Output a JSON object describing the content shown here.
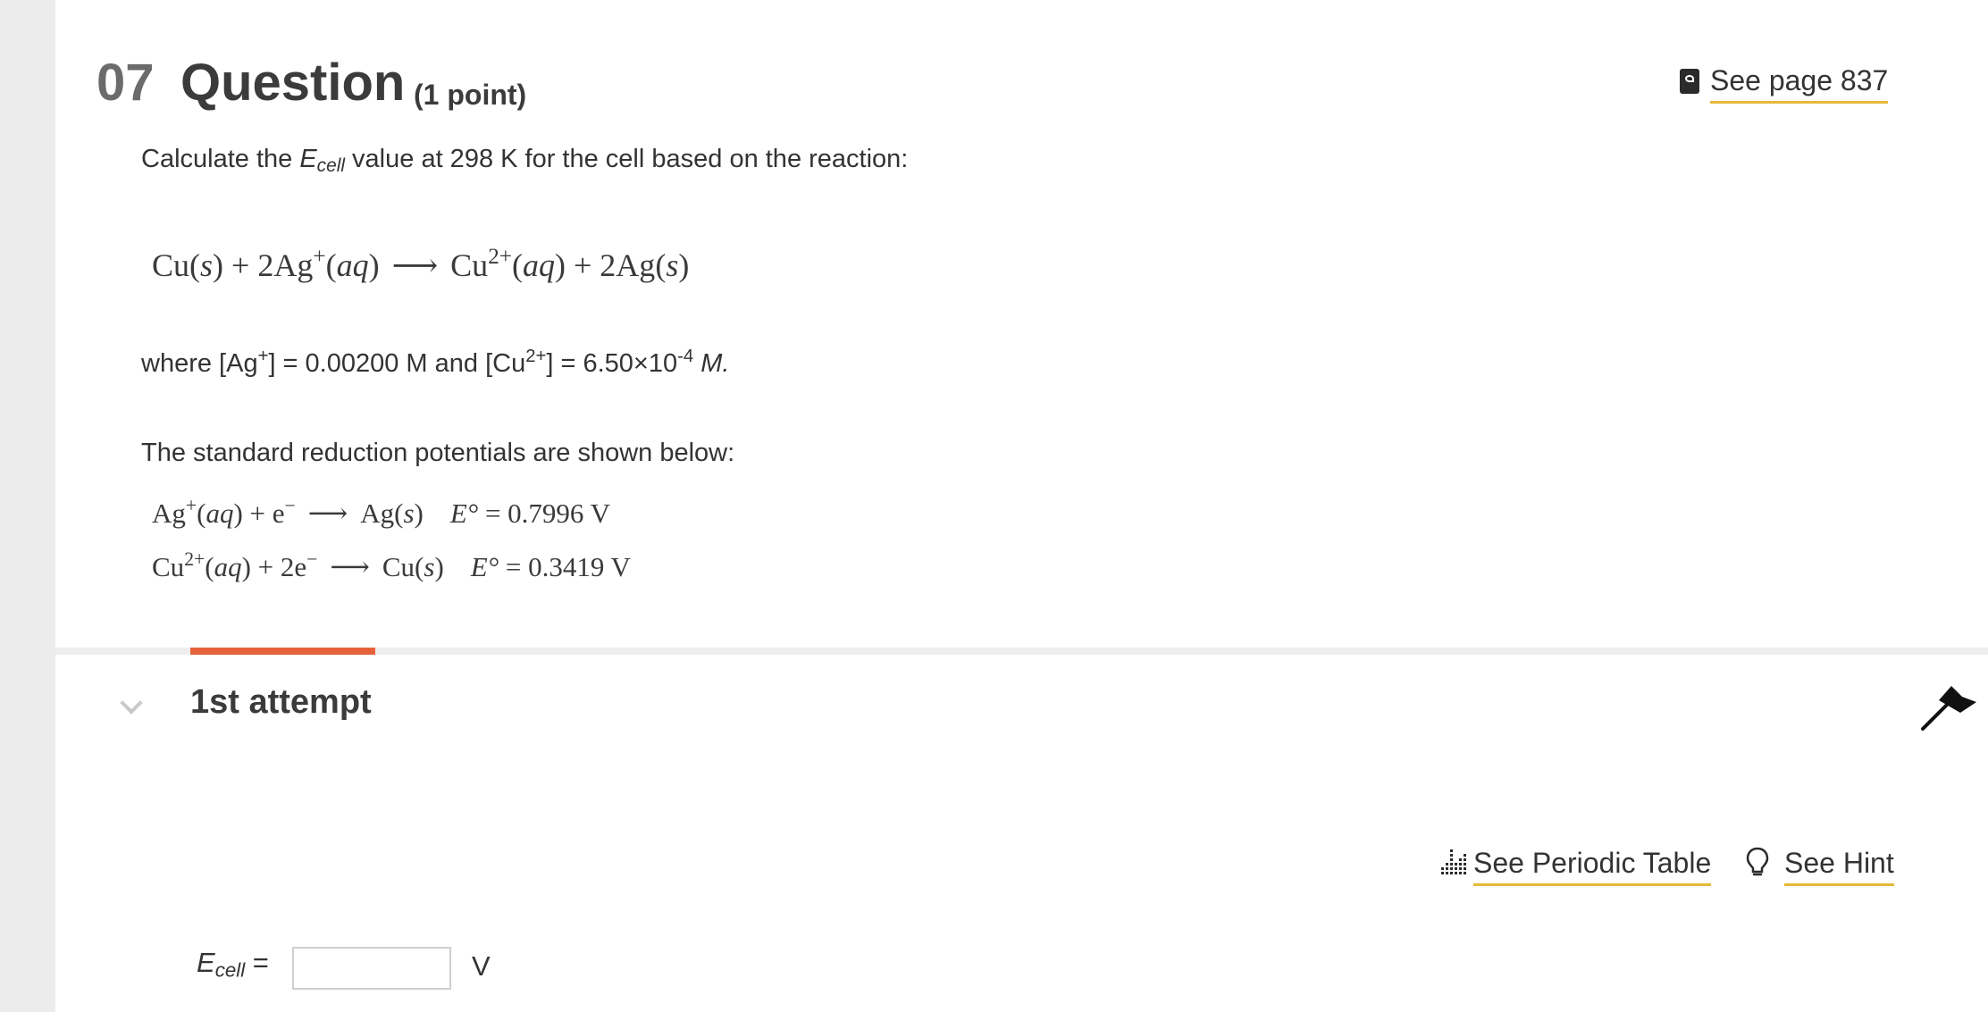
{
  "question": {
    "number": "07",
    "title": "Question",
    "points": "(1 point)",
    "see_page": "See page 837"
  },
  "prompt": {
    "before": "Calculate the ",
    "e": "E",
    "e_sub": "cell",
    "after": " value at 298 K for the cell based on the reaction:"
  },
  "reaction": {
    "cu": "Cu",
    "s": "s",
    "plus_2ag": " + 2Ag",
    "ag_charge": "+",
    "aq": "aq",
    "arrow": "⟶",
    "cu2": "Cu",
    "cu_charge": "2+",
    "plus_2ag_product": " + 2Ag"
  },
  "concentrations": {
    "t1": "where [Ag",
    "ag_sup": "+",
    "t2": "] = 0.00200 M and [Cu",
    "cu_sup": "2+",
    "t3": "] = 6.50×10",
    "exp": "-4",
    "unit": " M."
  },
  "standard": {
    "label": "The standard reduction potentials are shown below:",
    "half1": {
      "ion": "Ag",
      "charge": "+",
      "electrons": " + e",
      "electron_charge": "−",
      "product": "Ag",
      "state": "s",
      "e0_label": "E°",
      "e0_value": " = 0.7996 V"
    },
    "half2": {
      "ion": "Cu",
      "charge": "2+",
      "electrons": " + 2e",
      "electron_charge": "−",
      "product": "Cu",
      "state": "s",
      "e0_label": "E°",
      "e0_value": " = 0.3419 V"
    }
  },
  "attempt": {
    "title": "1st attempt"
  },
  "tools": {
    "periodic_table": "See Periodic Table",
    "hint": "See Hint"
  },
  "answer": {
    "e": "E",
    "e_sub": "cell",
    "equals": " =",
    "value": "",
    "unit": "V"
  },
  "colors": {
    "accent_underline": "#e6b93a",
    "active_tab": "#e5623a"
  }
}
